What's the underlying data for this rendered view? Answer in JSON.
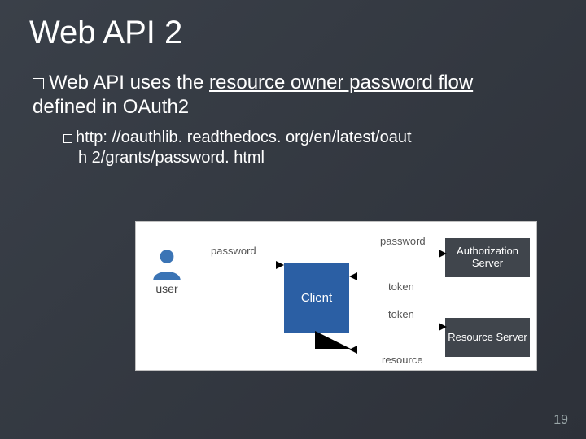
{
  "slide": {
    "title": "Web API 2",
    "bullet1_pre": "Web API uses the ",
    "bullet1_u": "resource owner password flow",
    "bullet1_post": " defined in OAuth2",
    "bullet2_pre": "http: //oauthlib. readthedocs. org/en/latest/oaut",
    "bullet2_line2": "h 2/grants/password. html",
    "page_number": "19"
  },
  "diagram": {
    "user_label": "user",
    "client_label": "Client",
    "auth_label": "Authorization Server",
    "resource_label": "Resource Server",
    "arrows": {
      "user_to_client": "password",
      "client_to_auth": "password",
      "auth_to_client": "token",
      "client_to_res": "token",
      "res_to_client": "resource"
    }
  }
}
